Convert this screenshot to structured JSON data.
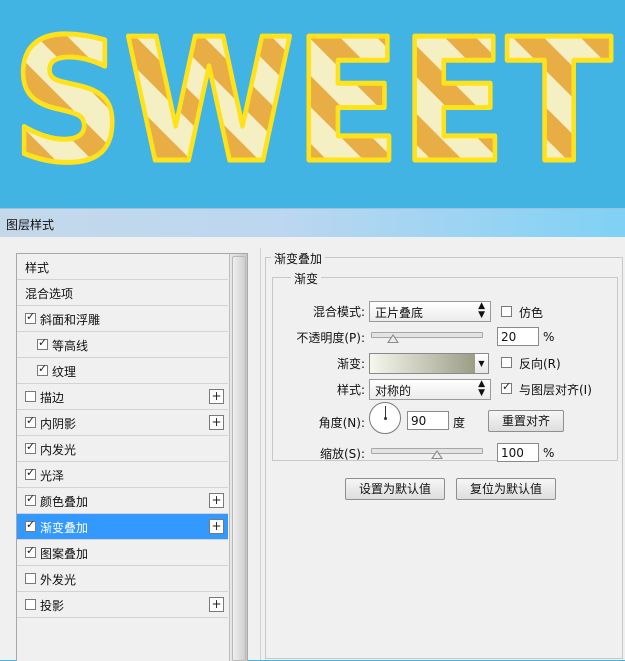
{
  "banner": {
    "text": "SWEET",
    "colors": {
      "background": "#42b4e3",
      "candy_fill": "#f5efc4",
      "candy_stripe": "#e8ae45",
      "candy_edge": "#ffe21a"
    }
  },
  "dialog": {
    "title": "图层样式",
    "styles_list": [
      {
        "label": "样式",
        "checkbox": false,
        "checked": false,
        "plus": false,
        "indent": 0,
        "selected": false
      },
      {
        "label": "混合选项",
        "checkbox": false,
        "checked": false,
        "plus": false,
        "indent": 0,
        "selected": false
      },
      {
        "label": "斜面和浮雕",
        "checkbox": true,
        "checked": true,
        "plus": false,
        "indent": 0,
        "selected": false
      },
      {
        "label": "等高线",
        "checkbox": true,
        "checked": true,
        "plus": false,
        "indent": 1,
        "selected": false
      },
      {
        "label": "纹理",
        "checkbox": true,
        "checked": true,
        "plus": false,
        "indent": 1,
        "selected": false
      },
      {
        "label": "描边",
        "checkbox": true,
        "checked": false,
        "plus": true,
        "indent": 0,
        "selected": false
      },
      {
        "label": "内阴影",
        "checkbox": true,
        "checked": true,
        "plus": true,
        "indent": 0,
        "selected": false
      },
      {
        "label": "内发光",
        "checkbox": true,
        "checked": true,
        "plus": false,
        "indent": 0,
        "selected": false
      },
      {
        "label": "光泽",
        "checkbox": true,
        "checked": true,
        "plus": false,
        "indent": 0,
        "selected": false
      },
      {
        "label": "颜色叠加",
        "checkbox": true,
        "checked": true,
        "plus": true,
        "indent": 0,
        "selected": false
      },
      {
        "label": "渐变叠加",
        "checkbox": true,
        "checked": true,
        "plus": true,
        "indent": 0,
        "selected": true
      },
      {
        "label": "图案叠加",
        "checkbox": true,
        "checked": true,
        "plus": false,
        "indent": 0,
        "selected": false
      },
      {
        "label": "外发光",
        "checkbox": true,
        "checked": false,
        "plus": false,
        "indent": 0,
        "selected": false
      },
      {
        "label": "投影",
        "checkbox": true,
        "checked": false,
        "plus": true,
        "indent": 0,
        "selected": false
      }
    ],
    "plus_symbol": "+",
    "check_symbol": "✓",
    "panel": {
      "section_title": "渐变叠加",
      "group_title": "渐变",
      "blend_mode": {
        "label": "混合模式:",
        "value": "正片叠底"
      },
      "dither": {
        "label": "仿色",
        "checked": false
      },
      "opacity": {
        "label": "不透明度(P):",
        "value": "20",
        "unit": "%",
        "slider_fraction": 0.2
      },
      "gradient": {
        "label": "渐变:",
        "colors": [
          "#f6f7ee",
          "#9c9d86"
        ]
      },
      "reverse": {
        "label": "反向(R)",
        "checked": false
      },
      "style": {
        "label": "样式:",
        "value": "对称的"
      },
      "align_with_layer": {
        "label": "与图层对齐(I)",
        "checked": true
      },
      "angle": {
        "label": "角度(N):",
        "value": "90",
        "unit": "度"
      },
      "reset_align_button": "重置对齐",
      "scale": {
        "label": "缩放(S):",
        "value": "100",
        "unit": "%",
        "slider_fraction": 0.6
      },
      "set_default_button": "设置为默认值",
      "reset_default_button": "复位为默认值"
    },
    "colors": {
      "selected_row": "#3399ff",
      "titlebar_end": "#7fd1f5"
    }
  }
}
